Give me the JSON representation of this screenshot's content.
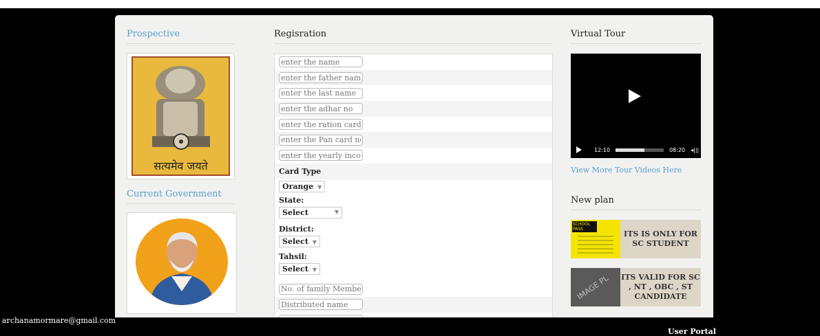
{
  "left": {
    "prospective_title": "Prospective",
    "emblem_caption": "सत्यमेव जयते",
    "current_government_title": "Current Government"
  },
  "registration": {
    "title": "Regisration",
    "fields": [
      {
        "placeholder": "enter the name"
      },
      {
        "placeholder": "enter the father name"
      },
      {
        "placeholder": "enter the last name"
      },
      {
        "placeholder": "enter the adhar no"
      },
      {
        "placeholder": "enter the ration card no"
      },
      {
        "placeholder": "enter the Pan card no"
      },
      {
        "placeholder": "enter the yearly income"
      }
    ],
    "card_type_label": "Card Type",
    "card_type_value": "Orange",
    "state_label": "State:",
    "state_value": "Select",
    "district_label": "District:",
    "district_value": "Select",
    "tahsil_label": "Tahsil:",
    "tahsil_value": "Select",
    "family_placeholder": "No. of family Member",
    "distributed_placeholder": "Distributed name"
  },
  "right": {
    "virtual_tour_title": "Virtual Tour",
    "video": {
      "current_time": "12:10",
      "duration": "08:20",
      "progress": 0.6
    },
    "more_videos_link": "View More Tour Videos Here",
    "new_plan_title": "New plan",
    "plans": [
      {
        "image_text": "SCHOOL PASS",
        "text": "ITS IS ONLY FOR SC STUDENT"
      },
      {
        "image_text": "IMAGE PL",
        "text": "ITS VALID FOR SC , NT , OBC , ST CANDIDATE"
      }
    ]
  },
  "footer": {
    "email": "archanamormare@gmail.com",
    "user_portal": "User Portal"
  },
  "colors": {
    "link": "#5aa0cc",
    "emblem_bg": "#e8b93c",
    "photo_bg": "#f1a21a"
  }
}
